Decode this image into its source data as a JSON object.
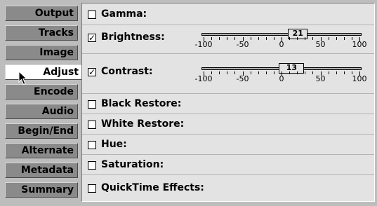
{
  "tabs": [
    {
      "label": "Output",
      "active": false
    },
    {
      "label": "Tracks",
      "active": false
    },
    {
      "label": "Image",
      "active": false
    },
    {
      "label": "Adjust",
      "active": true
    },
    {
      "label": "Encode",
      "active": false
    },
    {
      "label": "Audio",
      "active": false
    },
    {
      "label": "Begin/End",
      "active": false
    },
    {
      "label": "Alternate",
      "active": false
    },
    {
      "label": "Metadata",
      "active": false
    },
    {
      "label": "Summary",
      "active": false
    }
  ],
  "options": [
    {
      "label": "Gamma:",
      "checked": false
    },
    {
      "label": "Brightness:",
      "checked": true,
      "slider": {
        "value": "21",
        "min": -100,
        "max": 100,
        "tick_labels": [
          "-100",
          "-50",
          "0",
          "50",
          "100"
        ]
      }
    },
    {
      "label": "Contrast:",
      "checked": true,
      "slider": {
        "value": "13",
        "min": -100,
        "max": 100,
        "tick_labels": [
          "-100",
          "-50",
          "0",
          "50",
          "100"
        ]
      }
    },
    {
      "label": "Black Restore:",
      "checked": false
    },
    {
      "label": "White Restore:",
      "checked": false
    },
    {
      "label": "Hue:",
      "checked": false
    },
    {
      "label": "Saturation:",
      "checked": false
    },
    {
      "label": "QuickTime Effects:",
      "checked": false
    }
  ],
  "checkmark_glyph": "✓",
  "icons": {
    "cursor": "arrow-cursor-icon"
  }
}
